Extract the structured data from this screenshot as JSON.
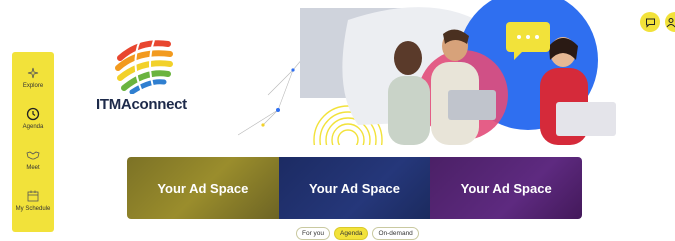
{
  "brand": {
    "name": "ITMAconnect"
  },
  "sidebar": {
    "items": [
      {
        "label": "Explore",
        "icon": "sparkle-icon"
      },
      {
        "label": "Agenda",
        "icon": "clock-icon"
      },
      {
        "label": "Meet",
        "icon": "handshake-icon"
      },
      {
        "label": "My Schedule",
        "icon": "calendar-icon"
      }
    ]
  },
  "top_icons": [
    "chat-icon",
    "user-icon"
  ],
  "ads": [
    {
      "label": "Your Ad Space"
    },
    {
      "label": "Your Ad Space"
    },
    {
      "label": "Your Ad Space"
    }
  ],
  "tabs": [
    {
      "label": "For you",
      "active": false
    },
    {
      "label": "Agenda",
      "active": true
    },
    {
      "label": "On-demand",
      "active": false
    }
  ],
  "colors": {
    "accent": "#f2e23a",
    "navy": "#1d2a4a",
    "purple": "#5e2a80",
    "olive": "#8a7f2a",
    "blue": "#2f6ff0"
  }
}
